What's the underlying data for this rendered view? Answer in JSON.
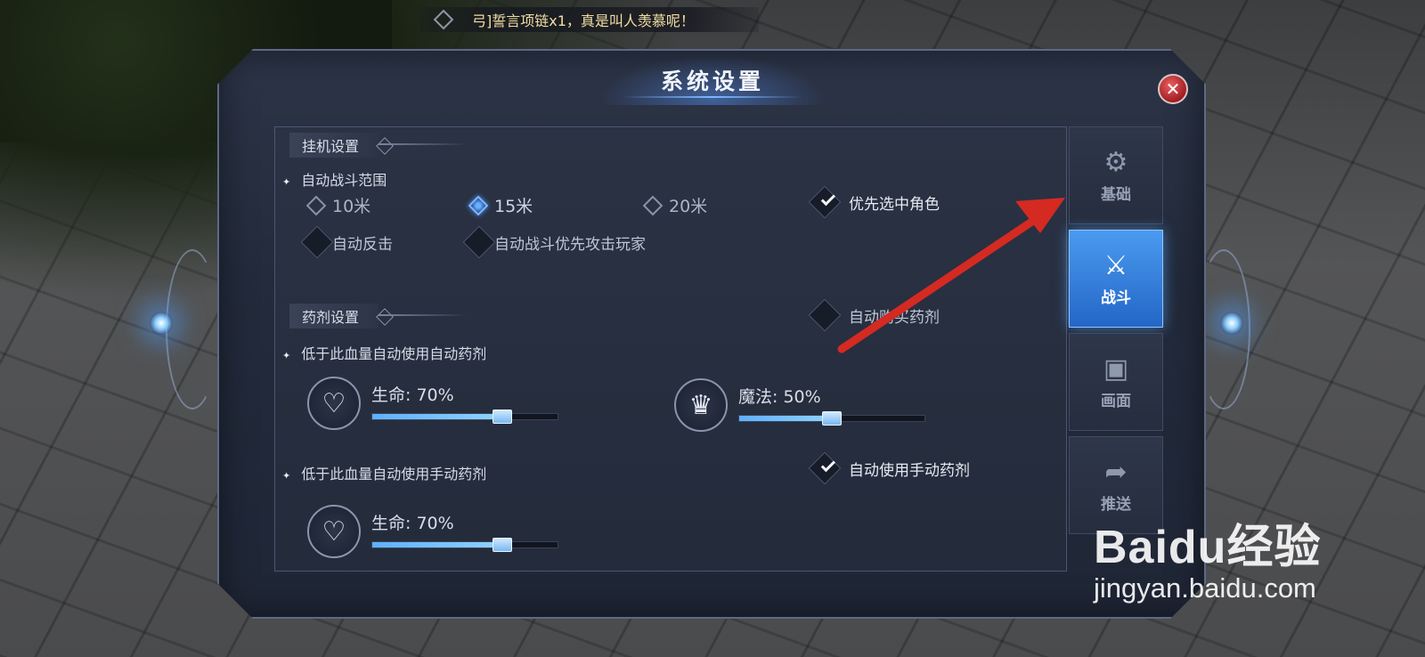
{
  "ticker": {
    "text": "弓]誓言项链x1，真是叫人羡慕呢！"
  },
  "panel": {
    "title": "系统设置",
    "close_symbol": "✕"
  },
  "idle_section": {
    "title": "挂机设置",
    "range_label": "自动战斗范围",
    "range_options": [
      {
        "label": "10米",
        "selected": false
      },
      {
        "label": "15米",
        "selected": true
      },
      {
        "label": "20米",
        "selected": false
      }
    ],
    "prefer_selected": {
      "label": "优先选中角色",
      "checked": true
    },
    "auto_counter": {
      "label": "自动反击",
      "checked": false
    },
    "prefer_players": {
      "label": "自动战斗优先攻击玩家",
      "checked": false
    }
  },
  "potion_section": {
    "title": "药剂设置",
    "auto_buy": {
      "label": "自动购买药剂",
      "checked": false
    },
    "auto_label": "低于此血量自动使用自动药剂",
    "hp_auto": {
      "label": "生命: 70%",
      "value": 70,
      "icon": "heart-potion-icon"
    },
    "mp_auto": {
      "label": "魔法: 50%",
      "value": 50,
      "icon": "mana-crown-icon"
    },
    "manual_label": "低于此血量自动使用手动药剂",
    "manual_toggle": {
      "label": "自动使用手动药剂",
      "checked": true
    },
    "hp_manual": {
      "label": "生命: 70%",
      "value": 70,
      "icon": "heart-potion-icon"
    }
  },
  "tabs": [
    {
      "label": "基础",
      "icon": "gear-icon",
      "active": false
    },
    {
      "label": "战斗",
      "icon": "sword-shield-icon",
      "active": true
    },
    {
      "label": "画面",
      "icon": "picture-icon",
      "active": false
    },
    {
      "label": "推送",
      "icon": "share-icon",
      "active": false
    }
  ],
  "annotation": {
    "color": "#d42a22"
  },
  "watermark": {
    "logo": "Baidu经验",
    "url": "jingyan.baidu.com"
  }
}
